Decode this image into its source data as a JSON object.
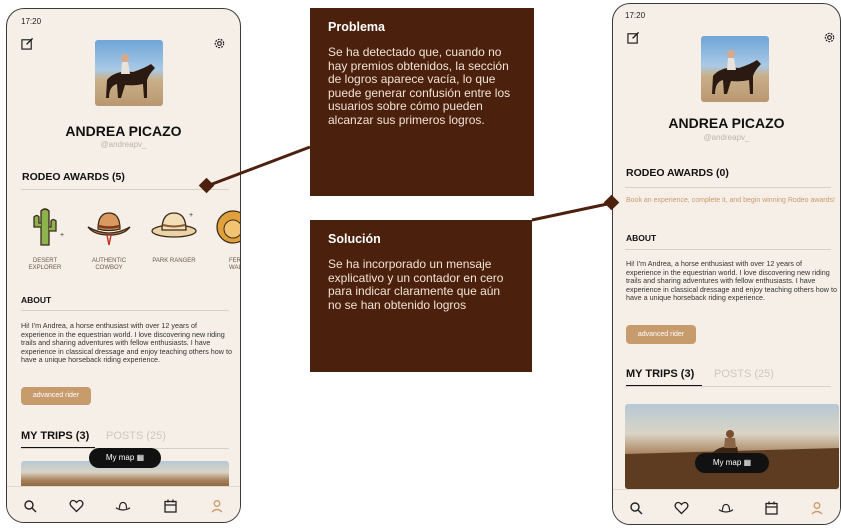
{
  "colors": {
    "accent": "#c89b6c",
    "note_bg": "#4b200c",
    "phone_bg": "#f6efe7"
  },
  "left_phone": {
    "status_time": "17:20",
    "name": "ANDREA PICAZO",
    "handle": "@andreapv_",
    "awards_title": "RODEO AWARDS (5)",
    "badges": [
      {
        "label": "DESERT EXPLORER",
        "icon": "cactus-icon"
      },
      {
        "label": "AUTHENTIC COWBOY",
        "icon": "cowboy-hat-icon"
      },
      {
        "label": "PARK RANGER",
        "icon": "ranger-hat-icon"
      },
      {
        "label": "FER WAL",
        "icon": "lion-icon"
      }
    ],
    "about_title": "ABOUT",
    "about_text": "Hi! I'm Andrea, a horse enthusiast with over 12 years of experience in the equestrian world. I love discovering new riding trails and sharing adventures with fellow enthusiasts. I have experience in classical dressage and enjoy teaching others how to have a unique horseback riding experience.",
    "chip": "advanced rider",
    "tab_trips": "MY TRIPS (3)",
    "tab_posts": "POSTS (25)",
    "map_button": "My map"
  },
  "right_phone": {
    "status_time": "17:20",
    "name": "ANDREA PICAZO",
    "handle": "@andreapv_",
    "awards_title": "RODEO AWARDS (0)",
    "awards_empty": "Book an experience, complete it, and begin winning Rodeo awards!",
    "about_title": "ABOUT",
    "about_text": "Hi! I'm Andrea, a horse enthusiast with over 12 years of experience in the equestrian world. I love discovering new riding trails and sharing adventures with fellow enthusiasts. I have experience in classical dressage and enjoy teaching others how to have a unique horseback riding experience.",
    "chip": "advanced rider",
    "tab_trips": "MY TRIPS (3)",
    "tab_posts": "POSTS (25)",
    "map_button": "My map"
  },
  "problem": {
    "title": "Problema",
    "text": "Se ha detectado que, cuando no hay premios obtenidos, la sección de logros aparece vacía, lo que puede generar confusión entre los usuarios sobre cómo pueden alcanzar sus primeros logros."
  },
  "solution": {
    "title": "Solución",
    "text": "Se ha incorporado un mensaje explicativo y un contador en cero para indicar claramente que aún no se han obtenido logros"
  },
  "nav_icons": [
    "search-icon",
    "heart-icon",
    "cowboy-hat-icon",
    "calendar-icon",
    "profile-icon"
  ]
}
